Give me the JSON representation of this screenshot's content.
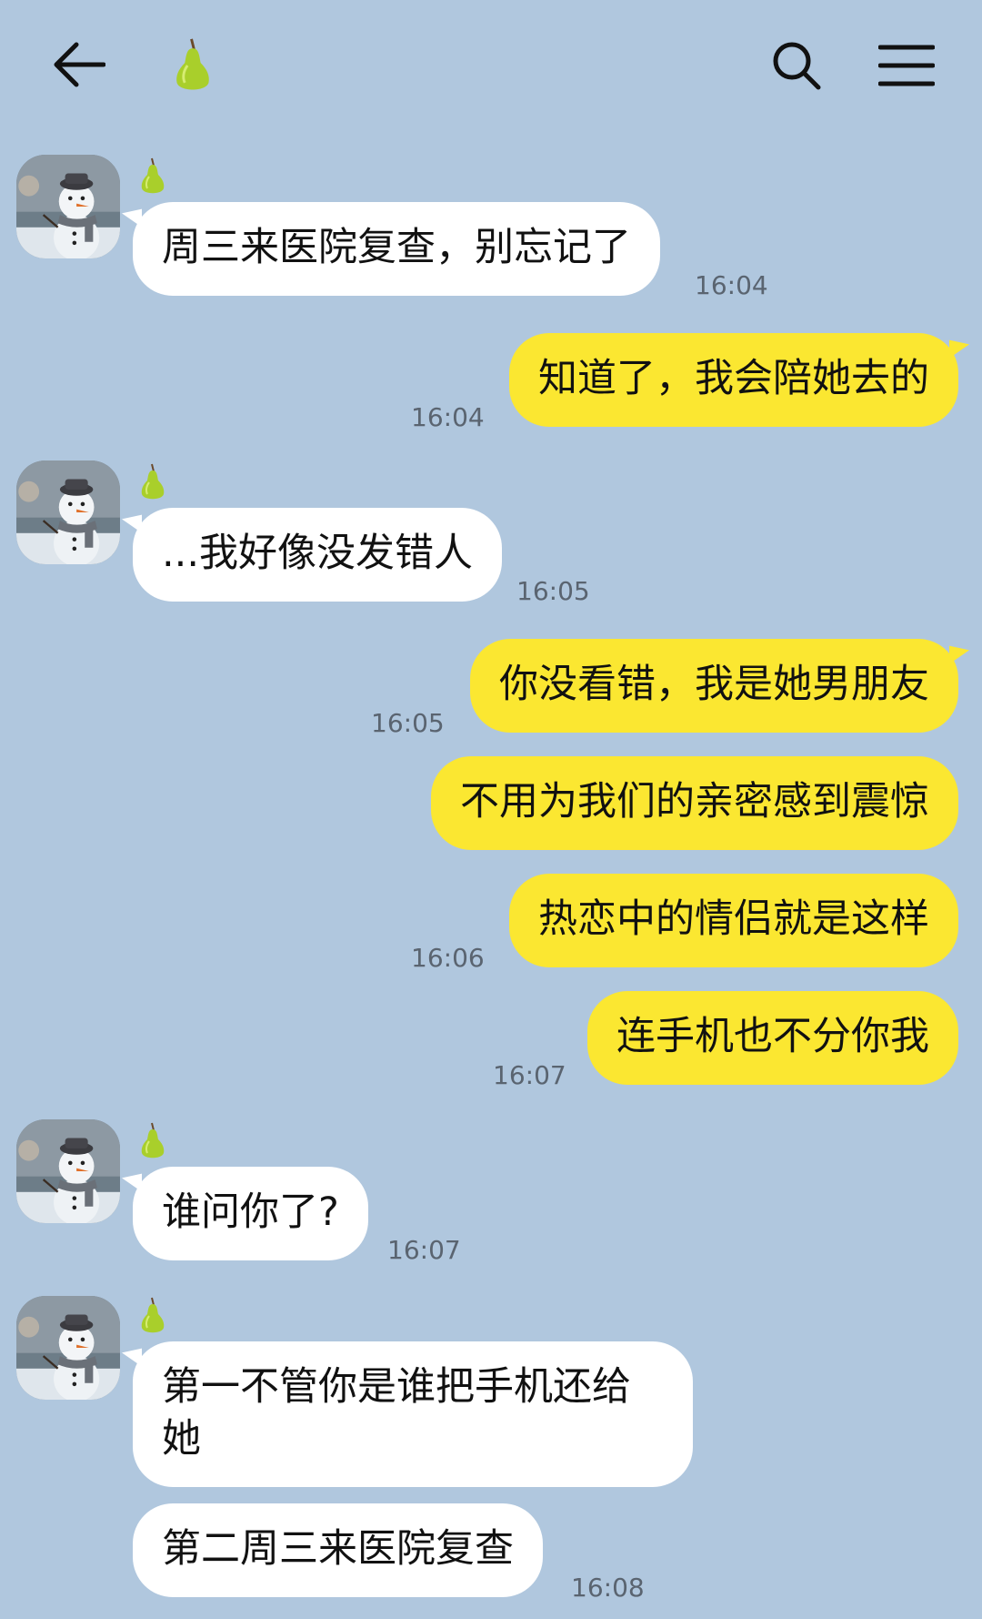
{
  "header": {
    "back_icon": "arrow-left-icon",
    "title_icon": "pear-icon",
    "search_icon": "search-icon",
    "menu_icon": "hamburger-menu-icon"
  },
  "colors": {
    "background": "#b0c7de",
    "incoming_bubble": "#ffffff",
    "outgoing_bubble": "#fbe731",
    "timestamp": "#5a6470"
  },
  "messages": [
    {
      "dir": "in",
      "text": "周三来医院复查，别忘记了",
      "time": "16:04"
    },
    {
      "dir": "out",
      "text": "知道了，我会陪她去的",
      "time": "16:04"
    },
    {
      "dir": "in",
      "text": "...我好像没发错人",
      "time": "16:05"
    },
    {
      "dir": "out",
      "text": "你没看错，我是她男朋友",
      "time": "16:05"
    },
    {
      "dir": "out",
      "text": "不用为我们的亲密感到震惊",
      "time": ""
    },
    {
      "dir": "out",
      "text": "热恋中的情侣就是这样",
      "time": "16:06"
    },
    {
      "dir": "out",
      "text": "连手机也不分你我",
      "time": "16:07"
    },
    {
      "dir": "in",
      "text": "谁问你了?",
      "time": "16:07"
    },
    {
      "dir": "in",
      "text": "第一不管你是谁把手机还给她",
      "time": ""
    },
    {
      "dir": "in",
      "text": "第二周三来医院复查",
      "time": "16:08"
    }
  ]
}
